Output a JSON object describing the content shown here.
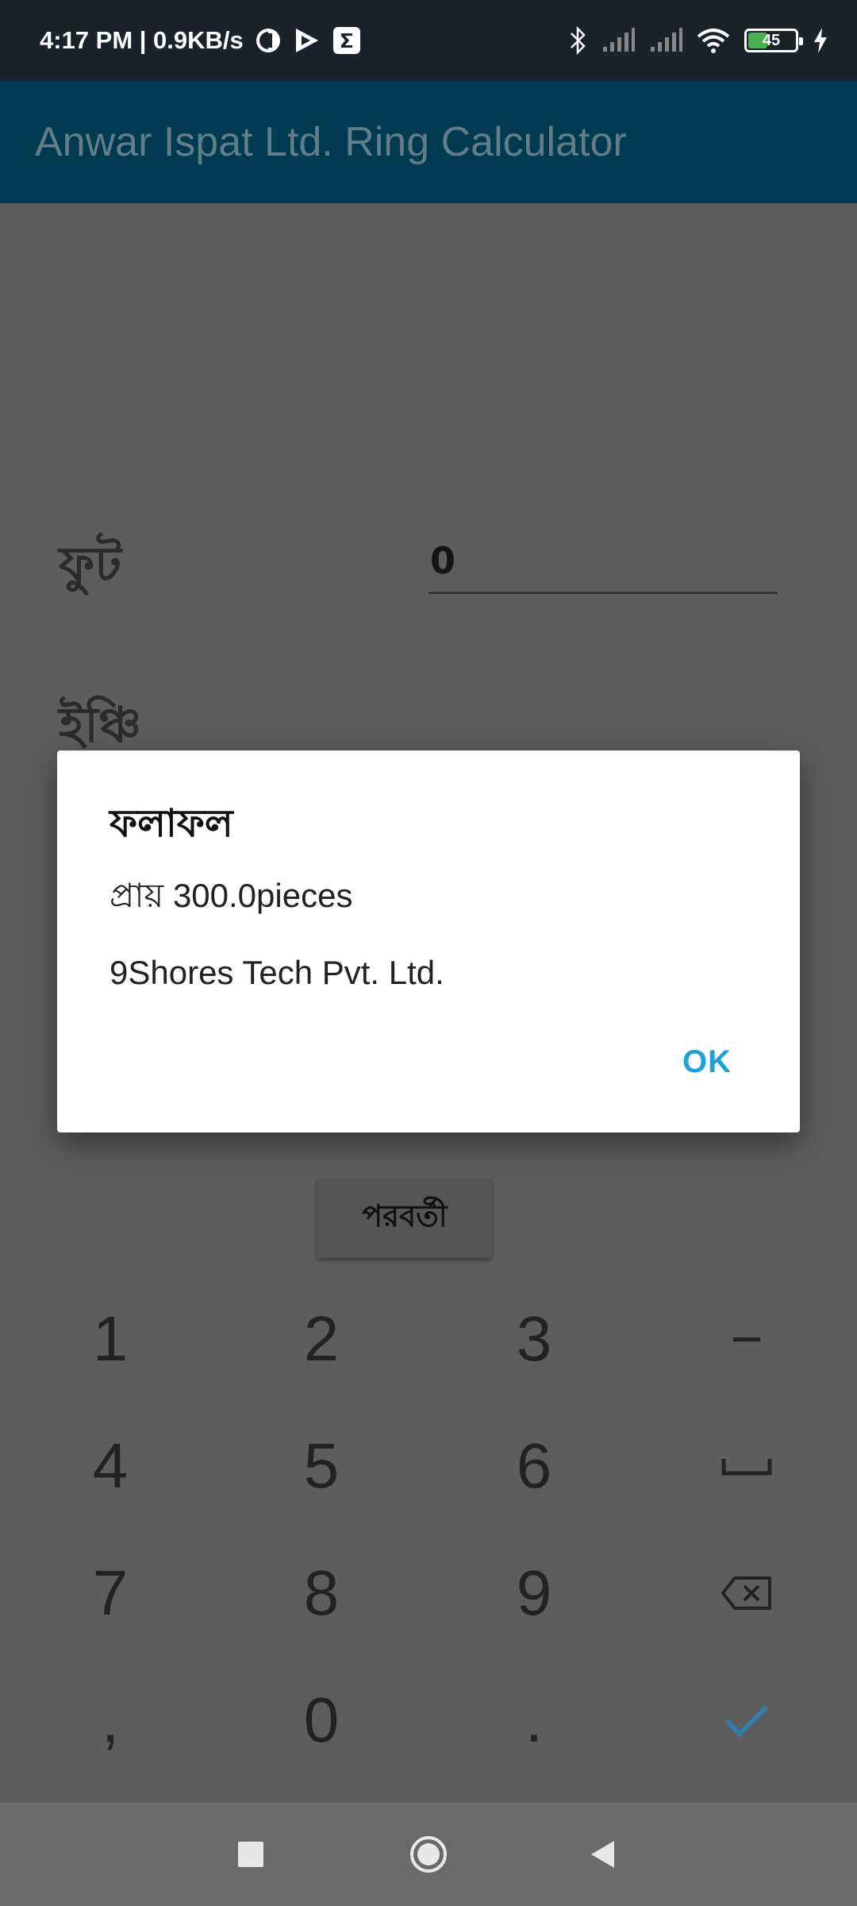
{
  "status_bar": {
    "time_speed": "4:17 PM | 0.9KB/s",
    "battery_level": "45",
    "battery_percent": 45,
    "icons": [
      "app-c-icon",
      "play-icon",
      "sigma-icon",
      "bluetooth-icon",
      "signal-icon",
      "signal-icon",
      "wifi-icon",
      "battery-icon",
      "charging-icon"
    ]
  },
  "app_bar": {
    "title": "Anwar Ispat Ltd. Ring Calculator"
  },
  "form": {
    "feet_label": "ফুট",
    "feet_value": "0",
    "inch_label": "ইঞ্চি",
    "next_button": "পরবর্তী"
  },
  "dialog": {
    "title": "ফলাফল",
    "message_line1": "প্রায় 300.0pieces",
    "message_line2": "9Shores Tech Pvt. Ltd.",
    "ok_label": "OK"
  },
  "keypad": {
    "keys": [
      [
        "1",
        "2",
        "3",
        "−"
      ],
      [
        "4",
        "5",
        "6",
        "space"
      ],
      [
        "7",
        "8",
        "9",
        "backspace"
      ],
      [
        ",",
        "0",
        ".",
        "done"
      ]
    ],
    "labels": {
      "k1": "1",
      "k2": "2",
      "k3": "3",
      "minus": "−",
      "k4": "4",
      "k5": "5",
      "k6": "6",
      "k7": "7",
      "k8": "8",
      "k9": "9",
      "comma": ",",
      "k0": "0",
      "dot": "."
    }
  },
  "colors": {
    "status_bar": "#1b2229",
    "app_bar": "#003a50",
    "scrim_background": "#5d5d5d",
    "dialog_accent": "#1aa3d6",
    "keypad_done": "#2f7fa8"
  }
}
